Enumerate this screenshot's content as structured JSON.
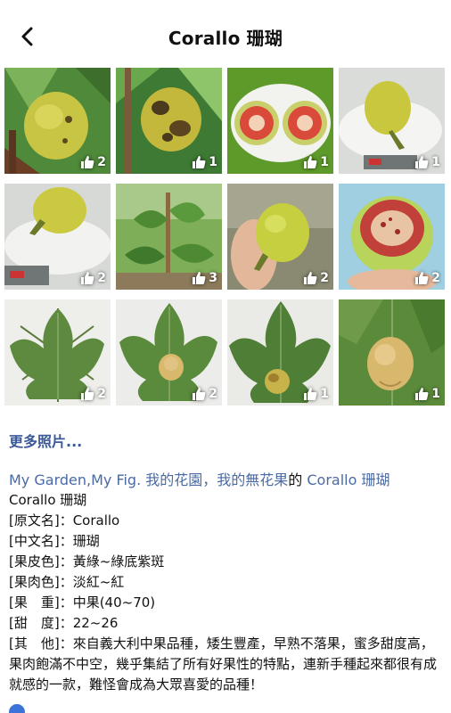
{
  "header": {
    "title": "Corallo 珊瑚"
  },
  "photos": [
    {
      "likes": "2"
    },
    {
      "likes": "1"
    },
    {
      "likes": "1"
    },
    {
      "likes": "1"
    },
    {
      "likes": "2"
    },
    {
      "likes": "3"
    },
    {
      "likes": "2"
    },
    {
      "likes": "2"
    },
    {
      "likes": "2"
    },
    {
      "likes": "2"
    },
    {
      "likes": "1"
    },
    {
      "likes": "1"
    }
  ],
  "more_photos": "更多照片...",
  "album": {
    "prefix": "My Garden,My Fig. 我的花園，我的無花果",
    "joiner": "的",
    "link": "Corallo 珊瑚"
  },
  "description": {
    "name": "Corallo 珊瑚",
    "lines": [
      "[原文名]：Corallo",
      "[中文名]：珊瑚",
      "[果皮色]：黃綠~綠底紫斑",
      "[果肉色]：淡紅~紅",
      "[果　重]：中果(40~70)",
      "[甜　度]：22~26"
    ],
    "other": "[其　他]：來自義大利中果品種，矮生豐產，早熟不落果，蜜多甜度高，果肉飽滿不中空，幾乎集結了所有好果性的特點，連新手種起來都很有成就感的一款，難怪會成為大眾喜愛的品種！"
  },
  "colors": {
    "link": "#4a6aa5",
    "more_photos": "#3b5998",
    "text": "#111111"
  },
  "icons": {
    "back": "chevron-left-icon",
    "likes": "thumbs-up-icon"
  }
}
